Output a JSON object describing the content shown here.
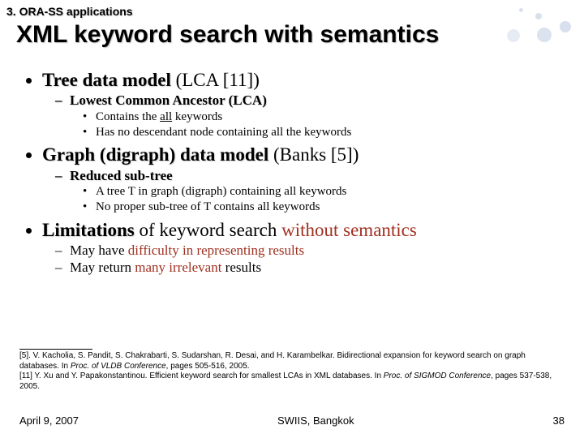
{
  "section_label": "3. ORA-SS applications",
  "title": "XML keyword search with semantics",
  "bullet1": {
    "lead": "Tree data model",
    "paren": " (LCA [11])",
    "sub_title": "Lowest Common Ancestor (LCA)",
    "details": {
      "d1_a": "Contains the ",
      "d1_b": "all",
      "d1_c": " keywords",
      "d2": "Has no descendant node containing all the keywords"
    }
  },
  "bullet2": {
    "lead": "Graph (digraph) data model",
    "paren": " (Banks [5])",
    "sub_title": "Reduced sub-tree",
    "details": {
      "d1": "A tree T in graph (digraph) containing all keywords",
      "d2": "No proper sub-tree of T contains all keywords"
    }
  },
  "bullet3": {
    "lead": "Limitations",
    "mid": " of keyword search ",
    "tail": "without semantics",
    "subs": {
      "s1_a": "May have ",
      "s1_b": "difficulty in representing results",
      "s2_a": "May return ",
      "s2_b": "many irrelevant",
      "s2_c": " results"
    }
  },
  "refs": {
    "r5_a": "[5].  V. Kacholia, S. Pandit, S. Chakrabarti, S. Sudarshan, R. Desai, and H. Karambelkar. Bidirectional expansion for keyword search on graph databases. In ",
    "r5_b": "Proc. of VLDB Conference",
    "r5_c": ", pages 505-516, 2005.",
    "r11_a": "[11]  Y. Xu and Y. Papakonstantinou. Efficient keyword search for smallest LCAs in XML databases. In ",
    "r11_b": "Proc. of SIGMOD Conference",
    "r11_c": ", pages 537-538, 2005."
  },
  "footer": {
    "date": "April 9, 2007",
    "venue": "SWIIS, Bangkok",
    "page": "38"
  }
}
